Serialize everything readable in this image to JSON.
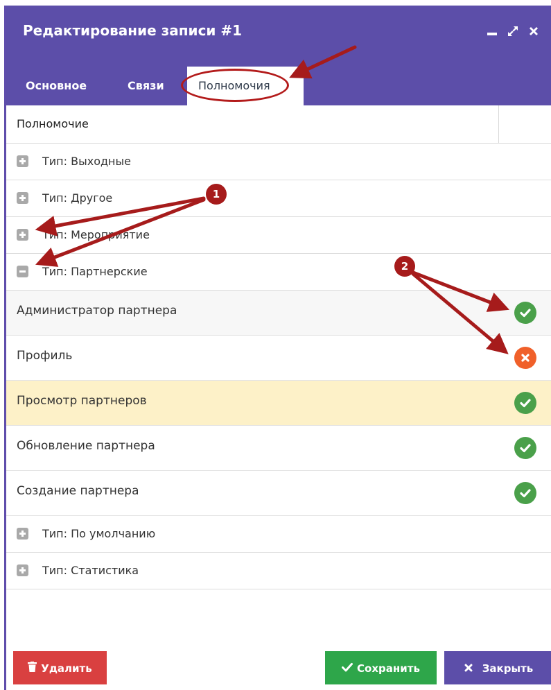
{
  "window": {
    "title": "Редактирование записи #1"
  },
  "tabs": [
    {
      "label": "Основное",
      "active": false
    },
    {
      "label": "Связи",
      "active": false
    },
    {
      "label": "Полномочия",
      "active": true
    }
  ],
  "grid": {
    "column_header": "Полномочие",
    "groups_before": [
      {
        "label": "Тип: Выходные",
        "expanded": false
      },
      {
        "label": "Тип: Другое",
        "expanded": false
      },
      {
        "label": "Тип: Мероприятие",
        "expanded": false
      },
      {
        "label": "Тип: Партнерские",
        "expanded": true
      }
    ],
    "items": [
      {
        "label": "Администратор партнера",
        "status": "allowed"
      },
      {
        "label": "Профиль",
        "status": "denied"
      },
      {
        "label": "Просмотр партнеров",
        "status": "allowed"
      },
      {
        "label": "Обновление партнера",
        "status": "allowed"
      },
      {
        "label": "Создание партнера",
        "status": "allowed"
      }
    ],
    "groups_after": [
      {
        "label": "Тип: По умолчанию",
        "expanded": false
      },
      {
        "label": "Тип: Статистика",
        "expanded": false
      }
    ]
  },
  "footer": {
    "delete_label": "Удалить",
    "save_label": "Сохранить",
    "close_label": "Закрыть"
  },
  "annotations": {
    "badge_1": "1",
    "badge_2": "2"
  },
  "colors": {
    "header": "#5c4ea9",
    "allowed": "#4aa04a",
    "denied": "#f0602a",
    "delete": "#d94040",
    "save": "#2ea64a",
    "highlight_row": "#fdf1c8",
    "annotation": "#a61b1b"
  }
}
